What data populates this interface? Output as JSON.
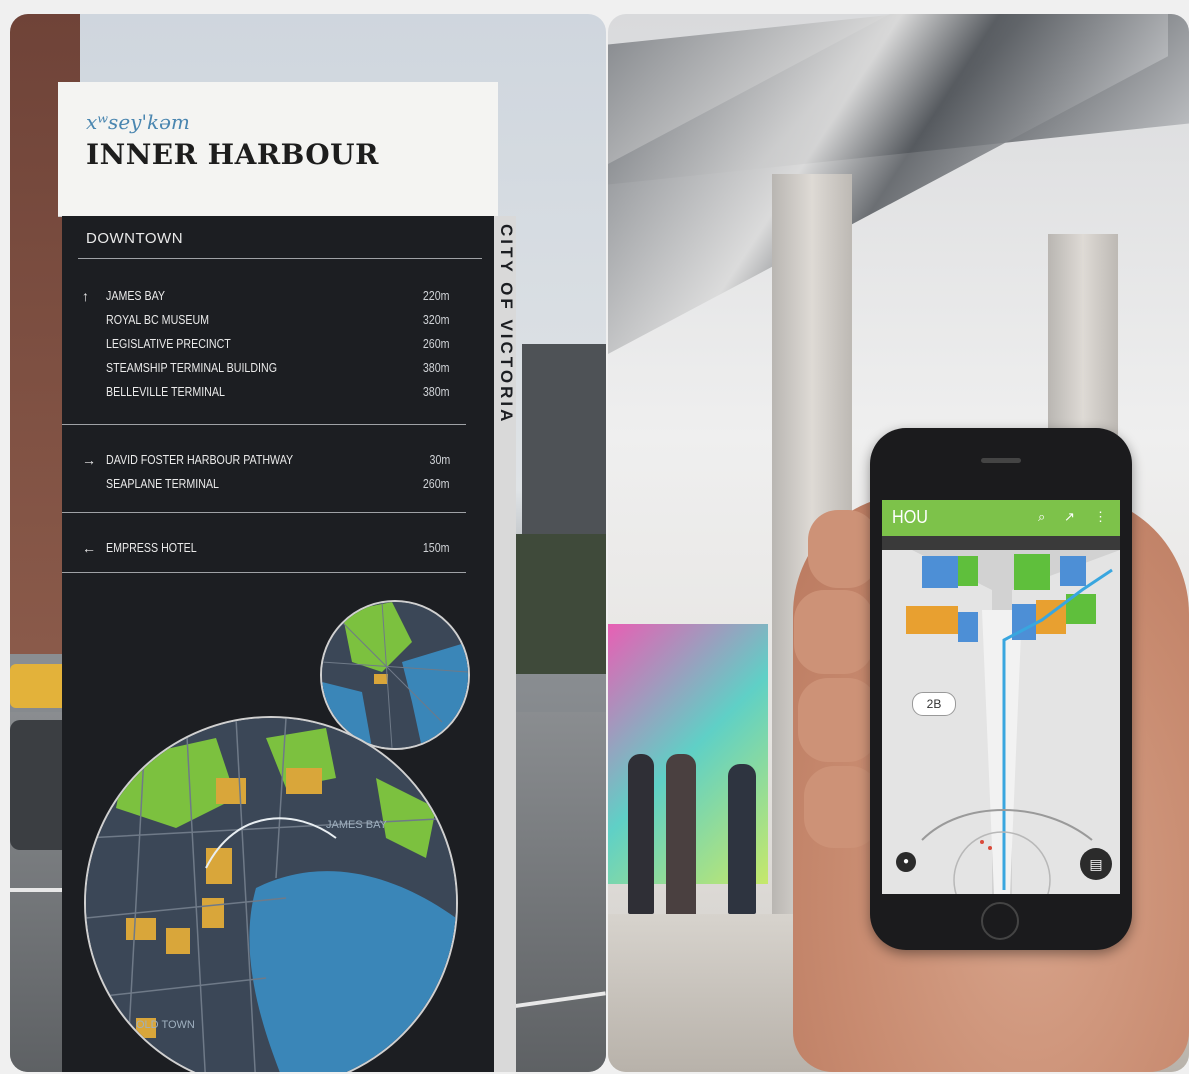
{
  "sign": {
    "subtitle": "xʷsey'kəm",
    "title": "INNER HARBOUR",
    "side_text": "CITY OF VICTORIA",
    "section_title": "DOWNTOWN",
    "groups": [
      {
        "arrow": "↑",
        "items": [
          {
            "name": "JAMES BAY",
            "distance": "220m"
          },
          {
            "name": "ROYAL BC MUSEUM",
            "distance": "320m"
          },
          {
            "name": "LEGISLATIVE PRECINCT",
            "distance": "260m"
          },
          {
            "name": "STEAMSHIP TERMINAL BUILDING",
            "distance": "380m"
          },
          {
            "name": "BELLEVILLE TERMINAL",
            "distance": "380m"
          }
        ]
      },
      {
        "arrow": "→",
        "items": [
          {
            "name": "DAVID FOSTER HARBOUR PATHWAY",
            "distance": "30m"
          },
          {
            "name": "SEAPLANE TERMINAL",
            "distance": "260m"
          }
        ]
      },
      {
        "arrow": "←",
        "items": [
          {
            "name": "EMPRESS HOTEL",
            "distance": "150m"
          }
        ]
      }
    ],
    "map_labels": {
      "james_bay": "JAMES BAY",
      "old_town": "OLD TOWN"
    }
  },
  "phone_app": {
    "title": "HOU",
    "gate_badge": "2B",
    "colors": {
      "app_bar": "#7dc24a",
      "zone_blue": "#4d8fd6",
      "zone_green": "#5fbf3c",
      "zone_orange": "#e8a030",
      "route": "#39a6df"
    }
  },
  "colors": {
    "sign_panel": "#1c1e22",
    "sign_header": "#f4f4f2",
    "map_water": "#3a86b8",
    "map_land": "#3b4757",
    "map_park": "#7cc13f",
    "map_highlight": "#d9a63a"
  }
}
